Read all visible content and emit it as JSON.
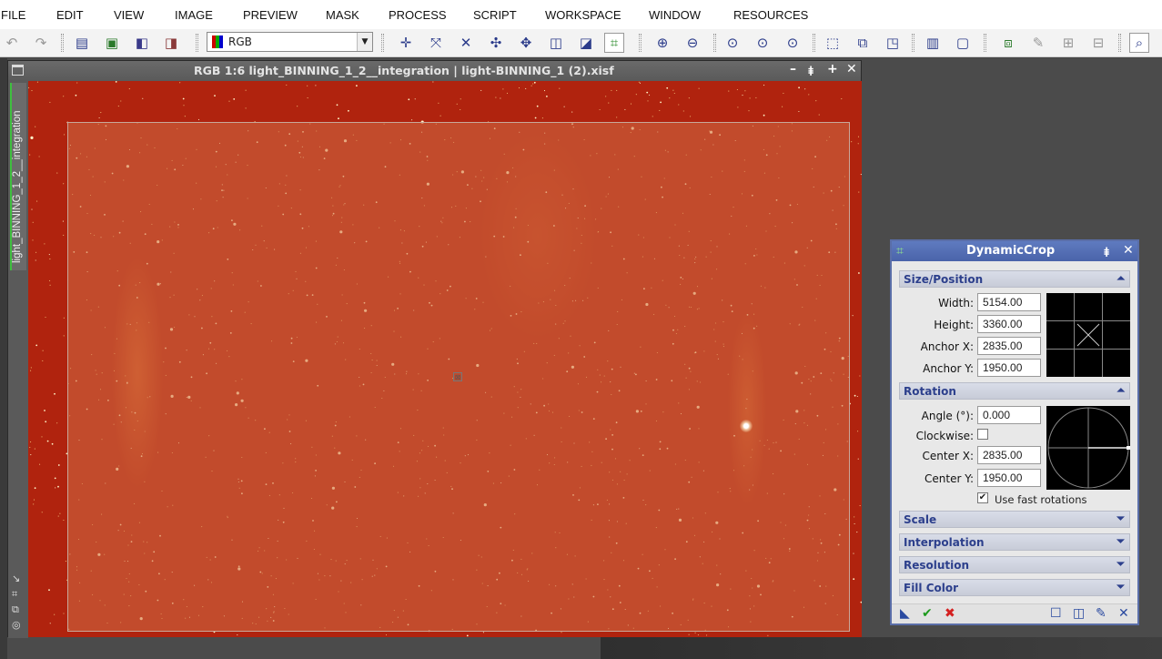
{
  "menu": [
    "FILE",
    "EDIT",
    "VIEW",
    "IMAGE",
    "PREVIEW",
    "MASK",
    "PROCESS",
    "SCRIPT",
    "WORKSPACE",
    "WINDOW",
    "RESOURCES"
  ],
  "toolbar": {
    "view_select_value": "RGB"
  },
  "image_window": {
    "title": "RGB 1:6 light_BINNING_1_2__integration | light-BINNING_1 (2).xisf",
    "side_tab_label": "light_BINNING_1_2__integration"
  },
  "dynamic_crop": {
    "title": "DynamicCrop",
    "size_position": {
      "header": "Size/Position",
      "width_label": "Width:",
      "width_value": "5154.00",
      "height_label": "Height:",
      "height_value": "3360.00",
      "anchor_x_label": "Anchor X:",
      "anchor_x_value": "2835.00",
      "anchor_y_label": "Anchor Y:",
      "anchor_y_value": "1950.00"
    },
    "rotation": {
      "header": "Rotation",
      "angle_label": "Angle (°):",
      "angle_value": "0.000",
      "clockwise_label": "Clockwise:",
      "clockwise_checked": false,
      "center_x_label": "Center X:",
      "center_x_value": "2835.00",
      "center_y_label": "Center Y:",
      "center_y_value": "1950.00",
      "fast_rotations_label": "Use fast rotations",
      "fast_rotations_checked": true
    },
    "collapsed_sections": [
      "Scale",
      "Interpolation",
      "Resolution",
      "Fill Color"
    ]
  },
  "colors": {
    "panel_title": "#4a63aa",
    "section_text": "#2c3f8c",
    "image_background": "#b0230e",
    "active_tab_accent": "#3fbf3f"
  }
}
